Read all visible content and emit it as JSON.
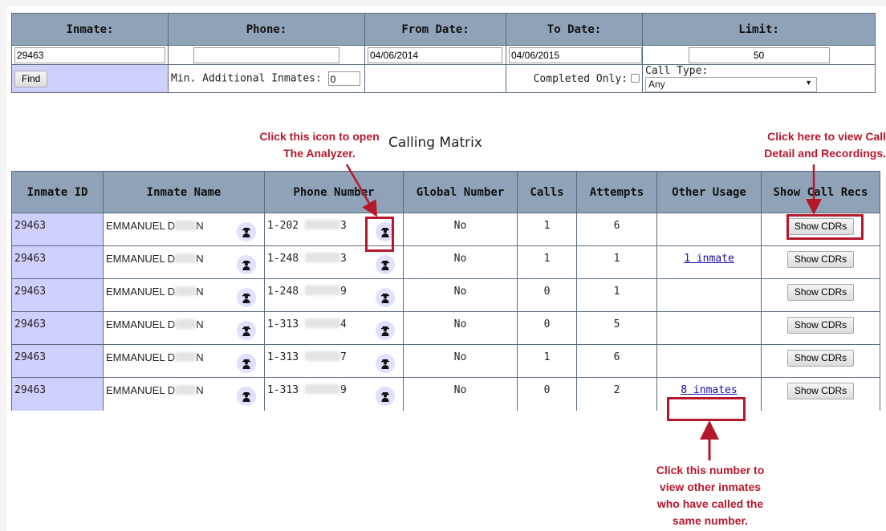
{
  "search": {
    "headers": [
      "Inmate:",
      "Phone:",
      "From Date:",
      "To Date:",
      "Limit:"
    ],
    "inmate_value": "29463",
    "phone_value": "",
    "from_date": "04/06/2014",
    "to_date": "04/06/2015",
    "limit": "50",
    "find_label": "Find",
    "min_additional_label": "Min. Additional Inmates:",
    "min_additional_value": "0",
    "completed_only_label": "Completed Only:",
    "completed_only_checked": false,
    "call_type_label": "Call Type:",
    "call_type_value": "Any"
  },
  "matrix": {
    "title": "Calling Matrix",
    "headers": [
      "Inmate ID",
      "Inmate Name",
      "Phone Number",
      "Global Number",
      "Calls",
      "Attempts",
      "Other Usage",
      "Show Call Recs"
    ],
    "rows": [
      {
        "id": "29463",
        "name_a": "EMMANUEL D",
        "name_b": "N",
        "phone_a": "1-202",
        "phone_b": "3",
        "global": "No",
        "calls": "1",
        "attempts": "6",
        "other": "",
        "cdr": "Show CDRs"
      },
      {
        "id": "29463",
        "name_a": "EMMANUEL D",
        "name_b": "N",
        "phone_a": "1-248",
        "phone_b": "3",
        "global": "No",
        "calls": "1",
        "attempts": "1",
        "other": "1 inmate",
        "cdr": "Show CDRs"
      },
      {
        "id": "29463",
        "name_a": "EMMANUEL D",
        "name_b": "N",
        "phone_a": "1-248",
        "phone_b": "9",
        "global": "No",
        "calls": "0",
        "attempts": "1",
        "other": "",
        "cdr": "Show CDRs"
      },
      {
        "id": "29463",
        "name_a": "EMMANUEL D",
        "name_b": "N",
        "phone_a": "1-313",
        "phone_b": "4",
        "global": "No",
        "calls": "0",
        "attempts": "5",
        "other": "",
        "cdr": "Show CDRs"
      },
      {
        "id": "29463",
        "name_a": "EMMANUEL D",
        "name_b": "N",
        "phone_a": "1-313",
        "phone_b": "7",
        "global": "No",
        "calls": "1",
        "attempts": "6",
        "other": "",
        "cdr": "Show CDRs"
      },
      {
        "id": "29463",
        "name_a": "EMMANUEL D",
        "name_b": "N",
        "phone_a": "1-313",
        "phone_b": "9",
        "global": "No",
        "calls": "0",
        "attempts": "2",
        "other": "8 inmates",
        "cdr": "Show CDRs"
      }
    ]
  },
  "annotations": {
    "analyzer_line1": "Click this icon to open",
    "analyzer_line2": "The Analyzer.",
    "cdr_line1": "Click here to view Call",
    "cdr_line2": "Detail and Recordings.",
    "inmates_line1": "Click this number to",
    "inmates_line2": "view other inmates",
    "inmates_line3": "who have called the",
    "inmates_line4": "same number."
  },
  "colors": {
    "header_bg": "#8fa2b8",
    "id_cell_bg": "#d0d0ff",
    "annotation_red": "#b5182b",
    "link_blue": "#1a0dab"
  },
  "icons": {
    "analyzer": "spy-person-icon",
    "dropdown": "chevron-down-icon"
  }
}
